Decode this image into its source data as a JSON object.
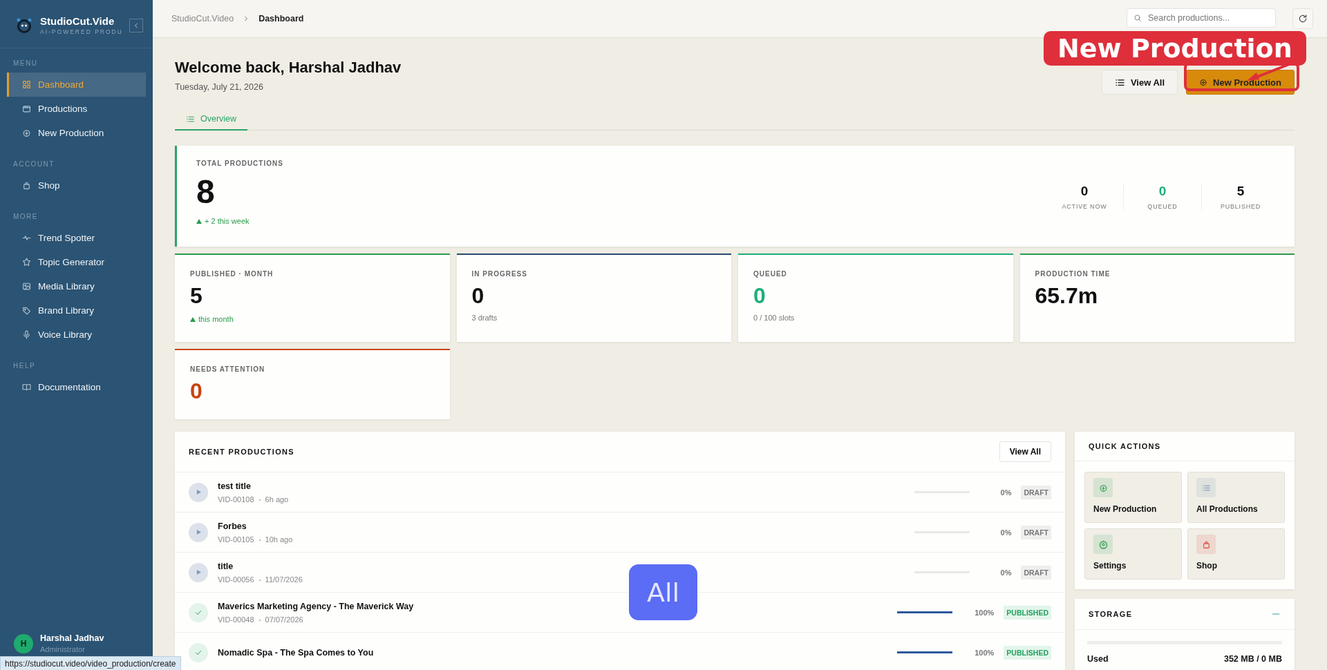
{
  "sidebar": {
    "brand": "StudioCut.Vide",
    "tagline": "AI-POWERED PRODU",
    "sections": [
      {
        "heading": "MENU",
        "items": [
          {
            "label": "Dashboard",
            "selected": true
          },
          {
            "label": "Productions",
            "selected": false
          },
          {
            "label": "New Production",
            "selected": false
          }
        ]
      },
      {
        "heading": "ACCOUNT",
        "items": [
          {
            "label": "Shop",
            "selected": false
          }
        ]
      },
      {
        "heading": "MORE",
        "items": [
          {
            "label": "Trend Spotter",
            "selected": false
          },
          {
            "label": "Topic Generator",
            "selected": false
          },
          {
            "label": "Media Library",
            "selected": false
          },
          {
            "label": "Brand Library",
            "selected": false
          },
          {
            "label": "Voice Library",
            "selected": false
          }
        ]
      },
      {
        "heading": "HELP",
        "items": [
          {
            "label": "Documentation",
            "selected": false
          }
        ]
      }
    ],
    "user": {
      "initial": "H",
      "name": "Harshal Jadhav",
      "role": "Administrator"
    }
  },
  "breadcrumb": [
    "StudioCut.Video",
    "Dashboard"
  ],
  "search": {
    "placeholder": "Search productions..."
  },
  "header": {
    "title": "Welcome back, Harshal Jadhav",
    "date": "Tuesday, July 21, 2026",
    "buttons": [
      {
        "label": "View All",
        "kind": "secondary"
      },
      {
        "label": "New Production",
        "kind": "primary"
      }
    ]
  },
  "tabs": [
    {
      "label": "Overview",
      "selected": true
    }
  ],
  "total": {
    "label": "TOTAL PRODUCTIONS",
    "value": "8",
    "trend": "+ 2 this week",
    "stats": [
      {
        "value": "0",
        "label": "ACTIVE NOW",
        "color": "#111111"
      },
      {
        "value": "0",
        "label": "QUEUED",
        "color": "#1fae7a"
      },
      {
        "value": "5",
        "label": "PUBLISHED",
        "color": "#111111"
      }
    ]
  },
  "stat_cards": [
    {
      "label": "PUBLISHED · MONTH",
      "value": "5",
      "note": "this month",
      "kind": "trend",
      "color": "#2e9b4f",
      "highlight": false
    },
    {
      "label": "IN PROGRESS",
      "value": "0",
      "note": "3 drafts",
      "kind": "plain",
      "color": "#2a4a6e",
      "highlight": false
    },
    {
      "label": "QUEUED",
      "value": "0",
      "note": "0 / 100 slots",
      "kind": "plain",
      "color": "#1fae7a",
      "highlight": true
    },
    {
      "label": "PRODUCTION TIME",
      "value": "65.7m",
      "color": "#2e9b4f",
      "highlight": false
    },
    {
      "label": "NEEDS ATTENTION",
      "value": "0",
      "color": "#c8440e",
      "highlight": true
    }
  ],
  "recent": {
    "title": "RECENT PRODUCTIONS",
    "button": "View All",
    "rows": [
      {
        "kind": "draft",
        "title": "test title",
        "id": "VID-00108",
        "time": "6h ago",
        "level": 0,
        "percent": "0%",
        "status": "DRAFT"
      },
      {
        "kind": "draft",
        "title": "Forbes",
        "id": "VID-00105",
        "time": "10h ago",
        "level": 0,
        "percent": "0%",
        "status": "DRAFT"
      },
      {
        "kind": "draft",
        "title": "title",
        "id": "VID-00056",
        "time": "11/07/2026",
        "level": 0,
        "percent": "0%",
        "status": "DRAFT"
      },
      {
        "kind": "published",
        "title": "Maverics Marketing Agency - The Maverick Way",
        "id": "VID-00048",
        "time": "07/07/2026",
        "level": 1,
        "percent": "100%",
        "status": "PUBLISHED"
      },
      {
        "kind": "published",
        "title": "Nomadic Spa - The Spa Comes to You",
        "level": 1,
        "percent": "100%",
        "status": "PUBLISHED"
      }
    ]
  },
  "quick_actions": {
    "title": "QUICK ACTIONS",
    "items": [
      {
        "label": "New Production",
        "color": "#2e9b4f"
      },
      {
        "label": "All Productions",
        "color": "#6f8fb0"
      },
      {
        "label": "Settings",
        "color": "#2e9b4f"
      },
      {
        "label": "Shop",
        "color": "#d9473a"
      }
    ]
  },
  "storage": {
    "title": "STORAGE",
    "level": 0,
    "label": "Used",
    "value": "352 MB / 0 MB"
  },
  "annotations": [
    {
      "kind": "callout",
      "text": "New Production"
    },
    {
      "kind": "badge",
      "text": "All"
    }
  ],
  "status_url": "https://studiocut.video/video_production/create"
}
